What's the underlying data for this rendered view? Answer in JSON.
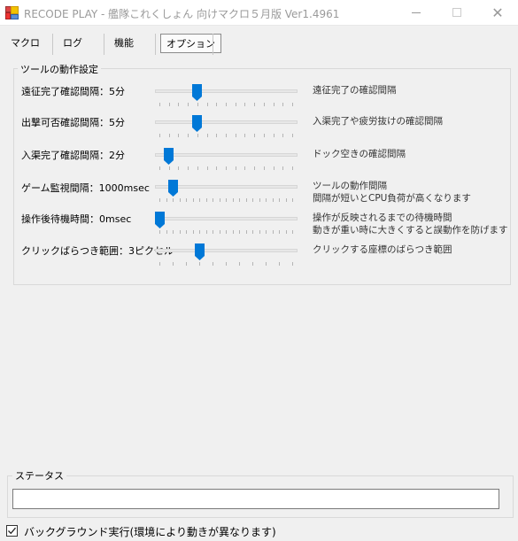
{
  "window": {
    "title": "RECODE PLAY - 艦隊これくしょん 向けマクロ５月版 Ver1.4961",
    "minimize_icon": "minimize-icon",
    "maximize_icon": "maximize-icon",
    "close_icon": "close-icon",
    "close_glyph": "✕"
  },
  "tabs": [
    {
      "label": "マクロ",
      "active": false
    },
    {
      "label": "ログ",
      "active": false
    },
    {
      "label": "機能",
      "active": false
    },
    {
      "label": "オプション",
      "active": true
    }
  ],
  "tool_settings": {
    "legend": "ツールの動作設定",
    "rows": [
      {
        "label": "遠征完了確認間隔：5分",
        "description": [
          "遠征完了の確認間隔"
        ],
        "slider": {
          "min": 1,
          "max": 15,
          "value": 5,
          "tick_count": 15
        }
      },
      {
        "label": "出撃可否確認間隔：5分",
        "description": [
          "入渠完了や疲労抜けの確認間隔"
        ],
        "slider": {
          "min": 1,
          "max": 15,
          "value": 5,
          "tick_count": 15
        }
      },
      {
        "label": "入渠完了確認間隔：2分",
        "description": [
          "ドック空きの確認間隔"
        ],
        "slider": {
          "min": 1,
          "max": 15,
          "value": 2,
          "tick_count": 15
        }
      },
      {
        "label": "ゲーム監視間隔：1000msec",
        "description": [
          "ツールの動作間隔",
          "間隔が短いとCPU負荷が高くなります"
        ],
        "slider": {
          "min": 0,
          "max": 10000,
          "value": 1000,
          "tick_count": 21
        }
      },
      {
        "label": "操作後待機時間：0msec",
        "description": [
          "操作が反映されるまでの待機時間",
          "動きが重い時に大きくすると誤動作を防げます"
        ],
        "slider": {
          "min": 0,
          "max": 10000,
          "value": 0,
          "tick_count": 21
        }
      },
      {
        "label": "クリックばらつき範囲：3ピクセル",
        "description": [
          "クリックする座標のばらつき範囲"
        ],
        "slider": {
          "min": 0,
          "max": 10,
          "value": 3,
          "tick_count": 11
        }
      }
    ]
  },
  "status": {
    "legend": "ステータス",
    "value": ""
  },
  "background_run": {
    "label": "バックグラウンド実行(環境により動きが異なります)",
    "checked": true,
    "check_glyph": "✓"
  },
  "colors": {
    "accent": "#0078d7",
    "window_bg": "#f0f0f0"
  }
}
